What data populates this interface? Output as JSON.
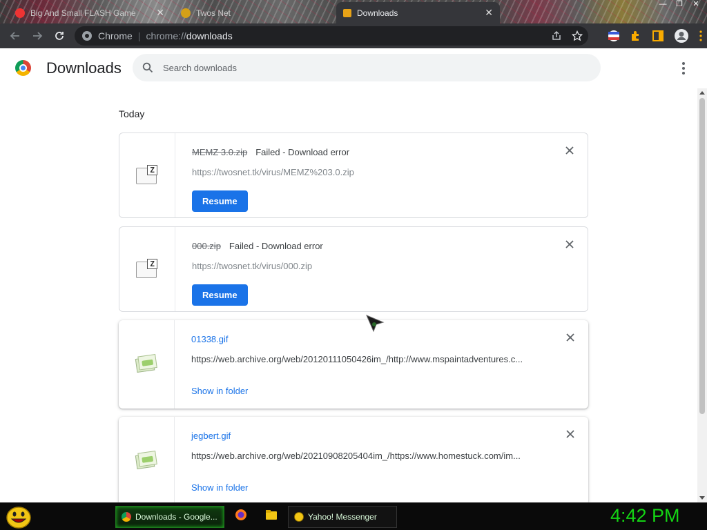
{
  "tabs": [
    {
      "title": "Big And Small FLASH Game",
      "icon": "flash-icon",
      "active": false
    },
    {
      "title": "Twos Net",
      "icon": "site-icon",
      "active": false
    },
    {
      "title": "Downloads",
      "icon": "downloads-icon",
      "active": true
    }
  ],
  "omnibox": {
    "site_label": "Chrome",
    "scheme": "chrome://",
    "host": "downloads"
  },
  "header": {
    "title": "Downloads",
    "search_placeholder": "Search downloads"
  },
  "section_label": "Today",
  "downloads": [
    {
      "filename": "MEMZ 3.0.zip",
      "status": "Failed - Download error",
      "url": "https://twosnet.tk/virus/MEMZ%203.0.zip",
      "action": "Resume",
      "state": "failed",
      "icon": "zip-file-icon"
    },
    {
      "filename": "000.zip",
      "status": "Failed - Download error",
      "url": "https://twosnet.tk/virus/000.zip",
      "action": "Resume",
      "state": "failed",
      "icon": "zip-file-icon"
    },
    {
      "filename": "01338.gif",
      "status": "",
      "url": "https://web.archive.org/web/20120111050426im_/http://www.mspaintadventures.c...",
      "action": "Show in folder",
      "state": "complete",
      "icon": "image-file-icon"
    },
    {
      "filename": "jegbert.gif",
      "status": "",
      "url": "https://web.archive.org/web/20210908205404im_/https://www.homestuck.com/im...",
      "action": "Show in folder",
      "state": "complete",
      "icon": "image-file-icon"
    }
  ],
  "taskbar": {
    "items": [
      {
        "label": "Downloads - Google...",
        "icon": "chrome-icon",
        "active": true
      },
      {
        "label": "Yahoo! Messenger",
        "icon": "yahoo-messenger-icon",
        "active": false
      }
    ],
    "clock": "4:42 PM"
  },
  "colors": {
    "accent": "#1a73e8",
    "toolbar": "#35363a",
    "clock": "#14d414"
  }
}
